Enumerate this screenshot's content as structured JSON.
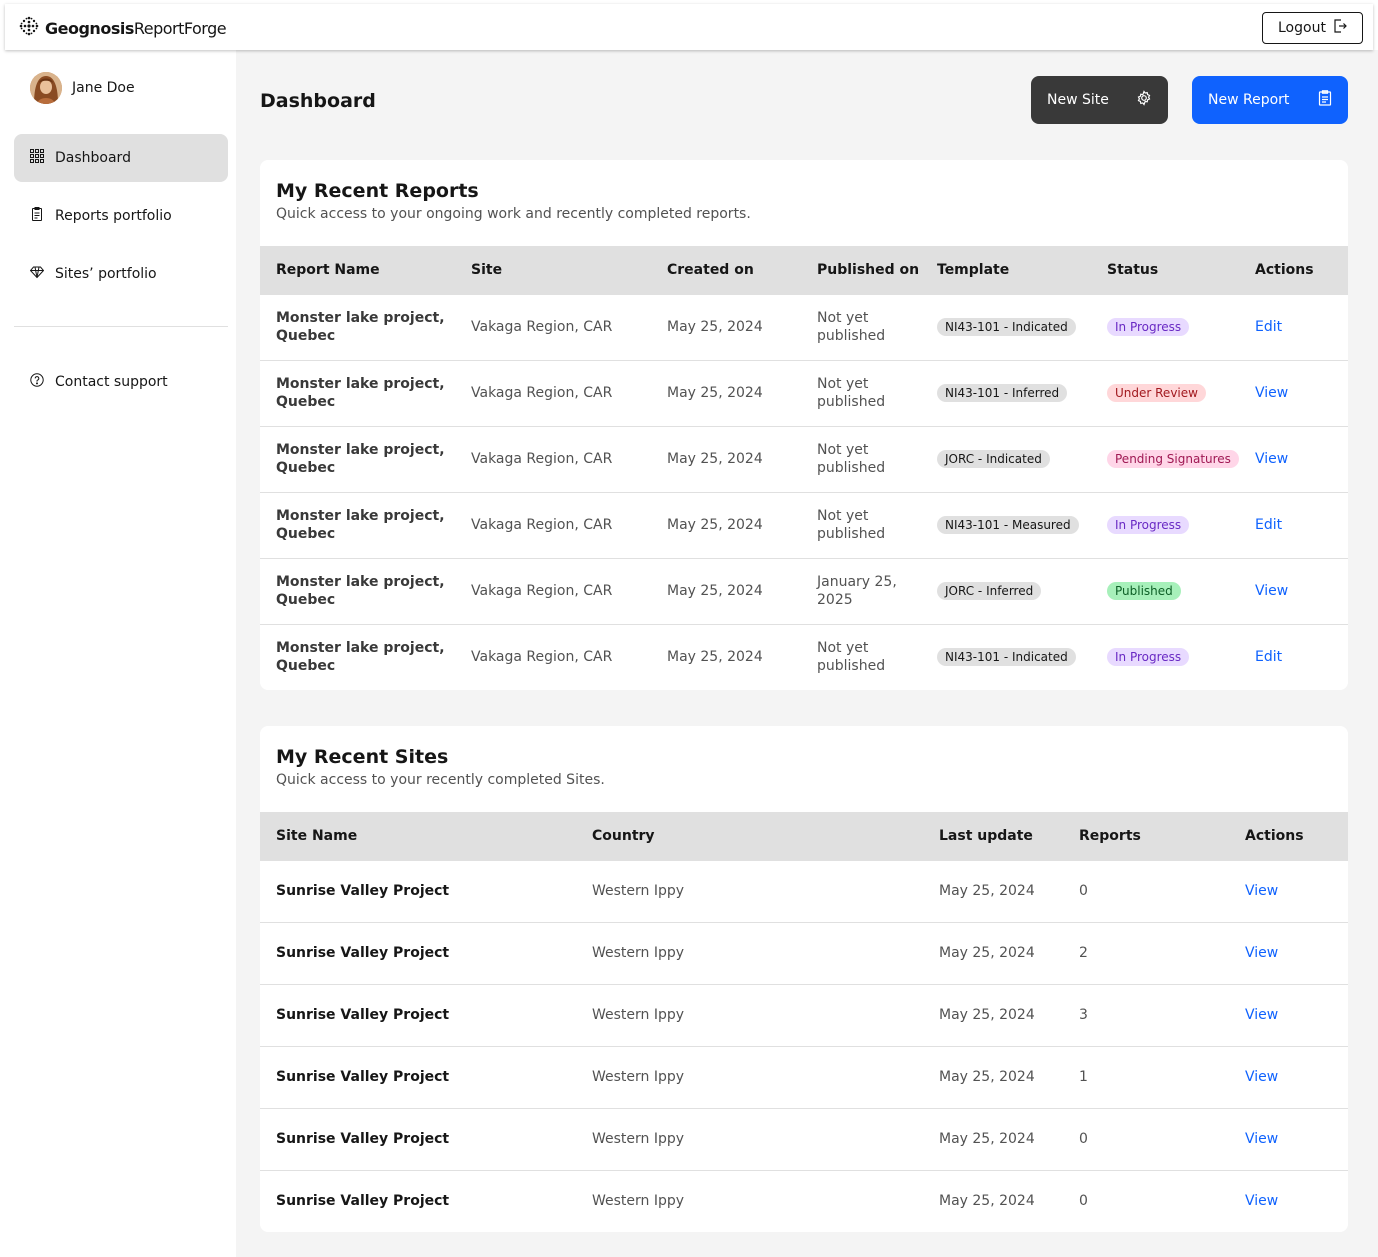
{
  "header": {
    "brand_bold": "Geognosis",
    "brand_light": "ReportForge",
    "logout_label": "Logout"
  },
  "user": {
    "name": "Jane Doe"
  },
  "sidebar": {
    "items": [
      {
        "label": "Dashboard",
        "icon": "grid-icon"
      },
      {
        "label": "Reports portfolio",
        "icon": "clipboard-icon"
      },
      {
        "label": "Sites’ portfolio",
        "icon": "diamond-icon"
      },
      {
        "label": "Contact support",
        "icon": "help-circle-icon"
      }
    ]
  },
  "page": {
    "title": "Dashboard",
    "new_site_label": "New Site",
    "new_report_label": "New Report"
  },
  "reports": {
    "title": "My Recent Reports",
    "subtitle": "Quick access to your ongoing work and recently completed reports.",
    "columns": [
      "Report Name",
      "Site",
      "Created on",
      "Published on",
      "Template",
      "Status",
      "Actions"
    ],
    "rows": [
      {
        "name": "Monster lake project, Quebec",
        "site": "Vakaga Region, CAR",
        "created": "May 25, 2024",
        "published": "Not yet published",
        "template": "NI43-101 - Indicated",
        "status": "In Progress",
        "action": "Edit"
      },
      {
        "name": "Monster lake project, Quebec",
        "site": "Vakaga Region, CAR",
        "created": "May 25, 2024",
        "published": "Not yet published",
        "template": "NI43-101 - Inferred",
        "status": "Under Review",
        "action": "View"
      },
      {
        "name": "Monster lake project, Quebec",
        "site": "Vakaga Region, CAR",
        "created": "May 25, 2024",
        "published": "Not yet published",
        "template": "JORC - Indicated",
        "status": "Pending Signatures",
        "action": "View"
      },
      {
        "name": "Monster lake project, Quebec",
        "site": "Vakaga Region, CAR",
        "created": "May 25, 2024",
        "published": "Not yet published",
        "template": "NI43-101 - Measured",
        "status": "In Progress",
        "action": "Edit"
      },
      {
        "name": "Monster lake project, Quebec",
        "site": "Vakaga Region, CAR",
        "created": "May 25, 2024",
        "published": "January 25, 2025",
        "template": "JORC - Inferred",
        "status": "Published",
        "action": "View"
      },
      {
        "name": "Monster lake project, Quebec",
        "site": "Vakaga Region, CAR",
        "created": "May 25, 2024",
        "published": "Not yet published",
        "template": "NI43-101 - Indicated",
        "status": "In Progress",
        "action": "Edit"
      }
    ]
  },
  "status_colors": {
    "In Progress": {
      "bg": "#e8daff",
      "fg": "#6929c4"
    },
    "Under Review": {
      "bg": "#ffd7d9",
      "fg": "#a2191f"
    },
    "Pending Signatures": {
      "bg": "#ffd6e8",
      "fg": "#9f1853"
    },
    "Published": {
      "bg": "#a7f0ba",
      "fg": "#0e6027"
    }
  },
  "sites": {
    "title": "My Recent Sites",
    "subtitle": "Quick access to your recently completed Sites.",
    "columns": [
      "Site Name",
      "Country",
      "Last update",
      "Reports",
      "Actions"
    ],
    "rows": [
      {
        "name": "Sunrise Valley Project",
        "country": "Western Ippy",
        "updated": "May 25, 2024",
        "reports": "0",
        "action": "View"
      },
      {
        "name": "Sunrise Valley Project",
        "country": "Western Ippy",
        "updated": "May 25, 2024",
        "reports": "2",
        "action": "View"
      },
      {
        "name": "Sunrise Valley Project",
        "country": "Western Ippy",
        "updated": "May 25, 2024",
        "reports": "3",
        "action": "View"
      },
      {
        "name": "Sunrise Valley Project",
        "country": "Western Ippy",
        "updated": "May 25, 2024",
        "reports": "1",
        "action": "View"
      },
      {
        "name": "Sunrise Valley Project",
        "country": "Western Ippy",
        "updated": "May 25, 2024",
        "reports": "0",
        "action": "View"
      },
      {
        "name": "Sunrise Valley Project",
        "country": "Western Ippy",
        "updated": "May 25, 2024",
        "reports": "0",
        "action": "View"
      }
    ]
  }
}
